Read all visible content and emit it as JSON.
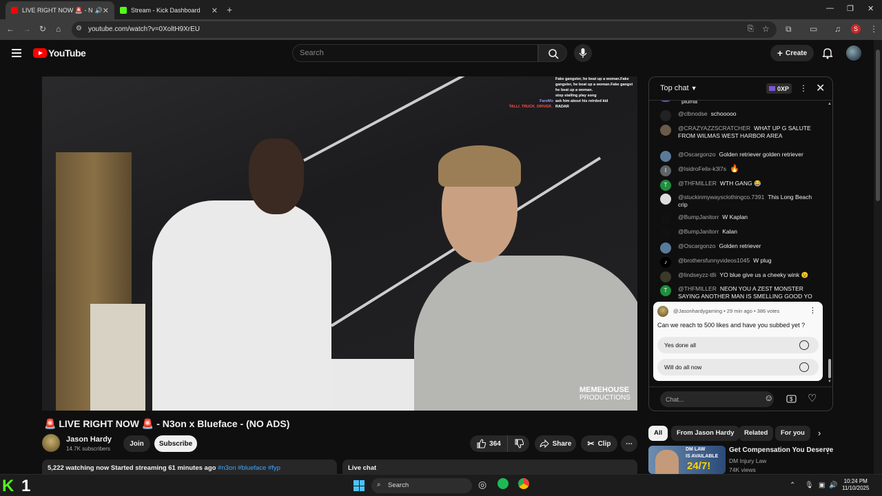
{
  "browser": {
    "tabs": [
      {
        "title": "LIVE RIGHT NOW 🚨 - N",
        "active": true
      },
      {
        "title": "Stream - Kick Dashboard",
        "active": false
      }
    ],
    "url": "youtube.com/watch?v=0XoltH9XrEU",
    "profile_initial": "S"
  },
  "masthead": {
    "logo_text": "YouTube",
    "search_placeholder": "Search",
    "create_label": "Create"
  },
  "video": {
    "title": "🚨 LIVE RIGHT NOW 🚨 - N3on x Blueface - (NO ADS)",
    "overlay_chat": [
      {
        "user": "",
        "text": "Fake gangster, he beat up a woman.Fake"
      },
      {
        "user": "",
        "text": "gangster, he beat up a woman.Fake gangst"
      },
      {
        "user": "",
        "text": "he beat up a woman."
      },
      {
        "user": "",
        "text": "stop stalling play song"
      },
      {
        "user": "FaroMo",
        "text": "ask him about his retrded kid"
      },
      {
        "user": "TALLI_TRUCK_DRIVER_",
        "text": "RADAR"
      }
    ],
    "watermark": {
      "line1": "MEMEHOUSE",
      "line2": "PRODUCTIONS"
    }
  },
  "channel": {
    "name": "Jason Hardy",
    "subscribers": "14.7K subscribers",
    "join_label": "Join",
    "subscribe_label": "Subscribe"
  },
  "actions": {
    "likes": "364",
    "share_label": "Share",
    "clip_label": "Clip"
  },
  "description": {
    "watching": "5,222 watching now",
    "started": "Started streaming 61 minutes ago",
    "tags": "#n3on #blueface #fyp"
  },
  "live_chat_tab_label": "Live chat",
  "chat": {
    "mode": "Top chat",
    "xp": "0XP",
    "messages": [
      {
        "user": "",
        "text": "pluma",
        "avatar_color": "#6a4fc2",
        "avatar_letter": ""
      },
      {
        "user": "@clbnodse",
        "text": "schooooo",
        "avatar_color": "#222",
        "avatar_letter": ""
      },
      {
        "user": "@CRAZYAZZSCRATCHER",
        "text": "WHAT UP G SALUTE FROM WILMAS WEST HARBOR AREA",
        "avatar_color": "#6b5a4a",
        "avatar_letter": ""
      },
      {
        "user": "@Oscargonzo",
        "text": "Golden retriever golden retriever",
        "avatar_color": "#5a7a9a",
        "avatar_letter": ""
      },
      {
        "user": "@IsidroFelix-k3l7s",
        "text": "🔥",
        "avatar_color": "#5f6368",
        "avatar_letter": "I"
      },
      {
        "user": "@THFMILLER",
        "text": "WTH GANG 😂",
        "avatar_color": "#1e8e3e",
        "avatar_letter": "T"
      },
      {
        "user": "@stuckinmywaysclothingco.7391",
        "text": "This Long Beach crip",
        "avatar_color": "#ddd",
        "avatar_letter": ""
      },
      {
        "user": "@BumpJanitorr",
        "text": "W Kaplan",
        "avatar_color": "#111",
        "avatar_letter": ""
      },
      {
        "user": "@BumpJanitorr",
        "text": "Kalan",
        "avatar_color": "#111",
        "avatar_letter": ""
      },
      {
        "user": "@Oscargonzo",
        "text": "Golden retriever",
        "avatar_color": "#5a7a9a",
        "avatar_letter": ""
      },
      {
        "user": "@brothersfunnyvideos1045",
        "text": "W plug",
        "avatar_color": "#000",
        "avatar_letter": "♪"
      },
      {
        "user": "@lindseyzz-t8i",
        "text": "YO blue give us a cheeky wink 😉",
        "avatar_color": "#3a3a2a",
        "avatar_letter": ""
      },
      {
        "user": "@THFMILLER",
        "text": "NEON YOU A ZEST MONSTER SAYING ANOTHER MAN IS SMELLING GOOD YO",
        "avatar_color": "#1e8e3e",
        "avatar_letter": "T"
      }
    ],
    "poll": {
      "meta": "@Jasonhardygaming • 29 min ago • 386 votes",
      "question": "Can we reach to 500 likes and have you subbed yet ?",
      "options": [
        "Yes done all",
        "Will do all now"
      ]
    },
    "input_placeholder": "Chat..."
  },
  "chips": [
    "All",
    "From Jason Hardy",
    "Related",
    "For you"
  ],
  "recommendation": {
    "title": "Get Compensation You Deserve",
    "channel": "DM Injury Law",
    "views": "74K views",
    "thumb_line1": "DM LAW",
    "thumb_line2": "IS AVAILABLE",
    "thumb_line3": "24/7!"
  },
  "taskbar": {
    "kick_letter": "K",
    "kick_number": "1",
    "search_label": "Search",
    "time": "10:24 PM",
    "date": "11/10/2025"
  },
  "colors": {
    "youtube_red": "#ff0000",
    "kick_green": "#53fc18",
    "link_blue": "#3ea6ff"
  }
}
